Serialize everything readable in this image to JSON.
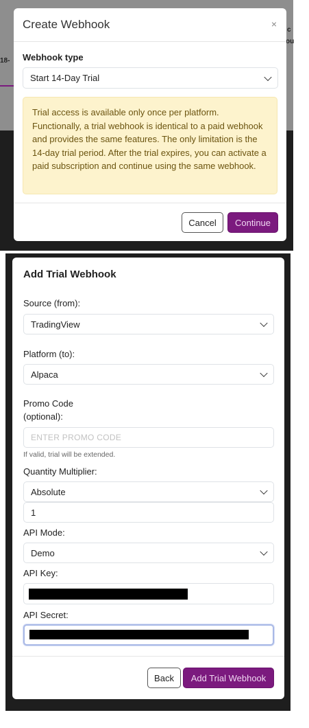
{
  "create_webhook": {
    "title": "Create Webhook",
    "close_glyph": "×",
    "type_label": "Webhook type",
    "type_value": "Start 14-Day Trial",
    "notice": "Trial access is available only once per platform. Functionally, a trial webhook is identical to a paid webhook and provides the same features. The only limitation is the 14-day trial period. After the trial expires, you can activate a paid subscription and continue using the same webhook.",
    "cancel_label": "Cancel",
    "continue_label": "Continue"
  },
  "background": {
    "peek_text_1": "c",
    "peek_text_2": "ou",
    "peek_text_3": "18-"
  },
  "add_trial_webhook": {
    "title": "Add Trial Webhook",
    "source_label": "Source (from):",
    "source_value": "TradingView",
    "platform_label": "Platform (to):",
    "platform_value": "Alpaca",
    "promo_label_line1": "Promo Code",
    "promo_label_line2": "(optional):",
    "promo_placeholder": "ENTER PROMO CODE",
    "promo_hint": "If valid, trial will be extended.",
    "quantity_label": "Quantity Multiplier:",
    "quantity_mode": "Absolute",
    "quantity_value": "1",
    "api_mode_label": "API Mode:",
    "api_mode_value": "Demo",
    "api_key_label": "API Key:",
    "api_secret_label": "API Secret:",
    "back_label": "Back",
    "submit_label": "Add Trial Webhook"
  },
  "colors": {
    "accent": "#7b1a7e",
    "notice_bg": "#fdf3cd",
    "notice_text": "#6b5410"
  }
}
